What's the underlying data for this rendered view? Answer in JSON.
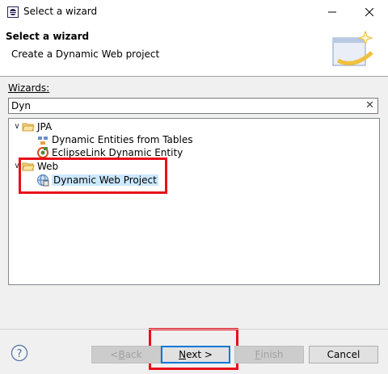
{
  "window": {
    "title": "Select a wizard"
  },
  "header": {
    "title": "Select a wizard",
    "description": "Create a Dynamic Web project"
  },
  "wizards": {
    "label": "Wizards:",
    "filter_value": "Dyn",
    "clear_glyph": "✕",
    "tree": {
      "jpa": {
        "label": "JPA",
        "children": [
          "Dynamic Entities from Tables",
          "EclipseLink Dynamic Entity"
        ]
      },
      "web": {
        "label": "Web",
        "children": [
          "Dynamic Web Project"
        ]
      }
    }
  },
  "buttons": {
    "back": {
      "pre": "< ",
      "mnemonic": "B",
      "rest": "ack"
    },
    "next": {
      "pre": "",
      "mnemonic": "N",
      "rest": "ext >"
    },
    "finish": {
      "pre": "",
      "mnemonic": "F",
      "rest": "inish"
    },
    "cancel": {
      "label": "Cancel"
    },
    "help": {
      "glyph": "?"
    }
  },
  "colors": {
    "highlight": "#e8101a",
    "selection": "#cce8ff",
    "default_button": "#0078d7"
  }
}
